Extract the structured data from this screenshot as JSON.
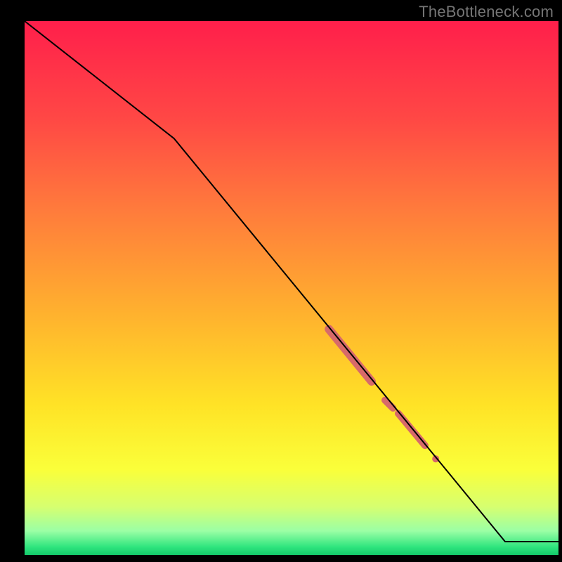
{
  "watermark": "TheBottleneck.com",
  "chart_data": {
    "type": "line",
    "title": "",
    "xlabel": "",
    "ylabel": "",
    "xlim": [
      0,
      100
    ],
    "ylim": [
      0,
      100
    ],
    "grid": false,
    "series": [
      {
        "name": "curve",
        "x": [
          0,
          28,
          90,
          100
        ],
        "values": [
          100,
          78,
          2.5,
          2.5
        ],
        "color": "#000000",
        "line_width": 2
      }
    ],
    "markers": [
      {
        "name": "thick-segment-1",
        "from": [
          57,
          42.3
        ],
        "to": [
          65,
          32.5
        ],
        "width": 12,
        "color": "#d76a6a"
      },
      {
        "name": "thick-segment-2",
        "from": [
          67.5,
          29.0
        ],
        "to": [
          69.0,
          27.5
        ],
        "width": 10,
        "color": "#d76a6a"
      },
      {
        "name": "thick-segment-3",
        "from": [
          70.0,
          26.5
        ],
        "to": [
          75.0,
          20.5
        ],
        "width": 10,
        "color": "#d76a6a"
      },
      {
        "name": "dot-1",
        "from": [
          77.0,
          18.0
        ],
        "to": [
          77.0,
          18.0
        ],
        "width": 10,
        "color": "#d76a6a"
      }
    ],
    "background_gradient": {
      "stops": [
        {
          "pos": 0.0,
          "color": "#ff1f4b"
        },
        {
          "pos": 0.18,
          "color": "#ff4745"
        },
        {
          "pos": 0.35,
          "color": "#ff7a3c"
        },
        {
          "pos": 0.55,
          "color": "#ffb22e"
        },
        {
          "pos": 0.72,
          "color": "#ffe326"
        },
        {
          "pos": 0.84,
          "color": "#faff3a"
        },
        {
          "pos": 0.91,
          "color": "#d6ff70"
        },
        {
          "pos": 0.955,
          "color": "#9bffa5"
        },
        {
          "pos": 0.985,
          "color": "#2fe57e"
        },
        {
          "pos": 1.0,
          "color": "#13c96a"
        }
      ]
    }
  }
}
